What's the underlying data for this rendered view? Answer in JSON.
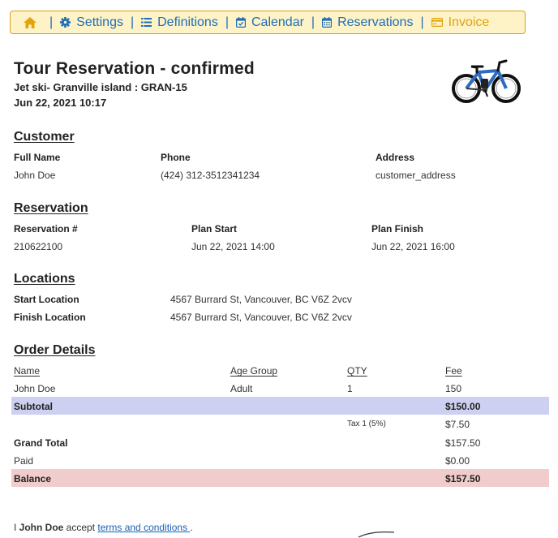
{
  "nav": {
    "items": [
      {
        "label": ""
      },
      {
        "label": "Settings"
      },
      {
        "label": "Definitions"
      },
      {
        "label": "Calendar"
      },
      {
        "label": "Reservations"
      },
      {
        "label": "Invoice"
      }
    ],
    "separator": "|"
  },
  "header": {
    "title": "Tour Reservation - confirmed",
    "subtitle": "Jet ski- Granville island : GRAN-15",
    "datetime": "Jun 22, 2021 10:17"
  },
  "customer": {
    "section_title": "Customer",
    "full_name_label": "Full Name",
    "full_name": "John Doe",
    "phone_label": "Phone",
    "phone": "(424) 312-3512341234",
    "address_label": "Address",
    "address": "customer_address"
  },
  "reservation": {
    "section_title": "Reservation",
    "number_label": "Reservation #",
    "number": "210622100",
    "plan_start_label": "Plan Start",
    "plan_start": "Jun 22, 2021 14:00",
    "plan_finish_label": "Plan Finish",
    "plan_finish": "Jun 22, 2021 16:00"
  },
  "locations": {
    "section_title": "Locations",
    "start_label": "Start Location",
    "start": "4567 Burrard St, Vancouver, BC V6Z 2vcv",
    "finish_label": "Finish Location",
    "finish": "4567 Burrard St, Vancouver, BC V6Z 2vcv"
  },
  "order": {
    "section_title": "Order Details",
    "headers": {
      "name": "Name",
      "age_group": "Age Group",
      "qty": "QTY",
      "fee": "Fee"
    },
    "rows": [
      {
        "name": "John Doe",
        "age_group": "Adult",
        "qty": "1",
        "fee": "150"
      }
    ],
    "subtotal_label": "Subtotal",
    "subtotal": "$150.00",
    "tax_label": "Tax 1 (5%)",
    "tax": "$7.50",
    "grand_total_label": "Grand Total",
    "grand_total": "$157.50",
    "paid_label": "Paid",
    "paid": "$0.00",
    "balance_label": "Balance",
    "balance": "$157.50"
  },
  "footer": {
    "prefix": "I ",
    "name": "John Doe",
    "middle": " accept ",
    "link": "terms and conditions ",
    "suffix": "."
  },
  "icons": {
    "home": "home-icon",
    "settings": "gear-icon",
    "definitions": "list-icon",
    "calendar": "calendar-check-icon",
    "reservations": "calendar-grid-icon",
    "invoice": "invoice-icon",
    "bike": "bicycle-image"
  },
  "colors": {
    "nav_bg": "#fdf3c7",
    "nav_border": "#d6a31b",
    "nav_link": "#1f6db8",
    "nav_active": "#e2a30e",
    "subtotal_band": "#cdd0f0",
    "balance_band": "#f1cccc",
    "link": "#1a5fb4"
  }
}
